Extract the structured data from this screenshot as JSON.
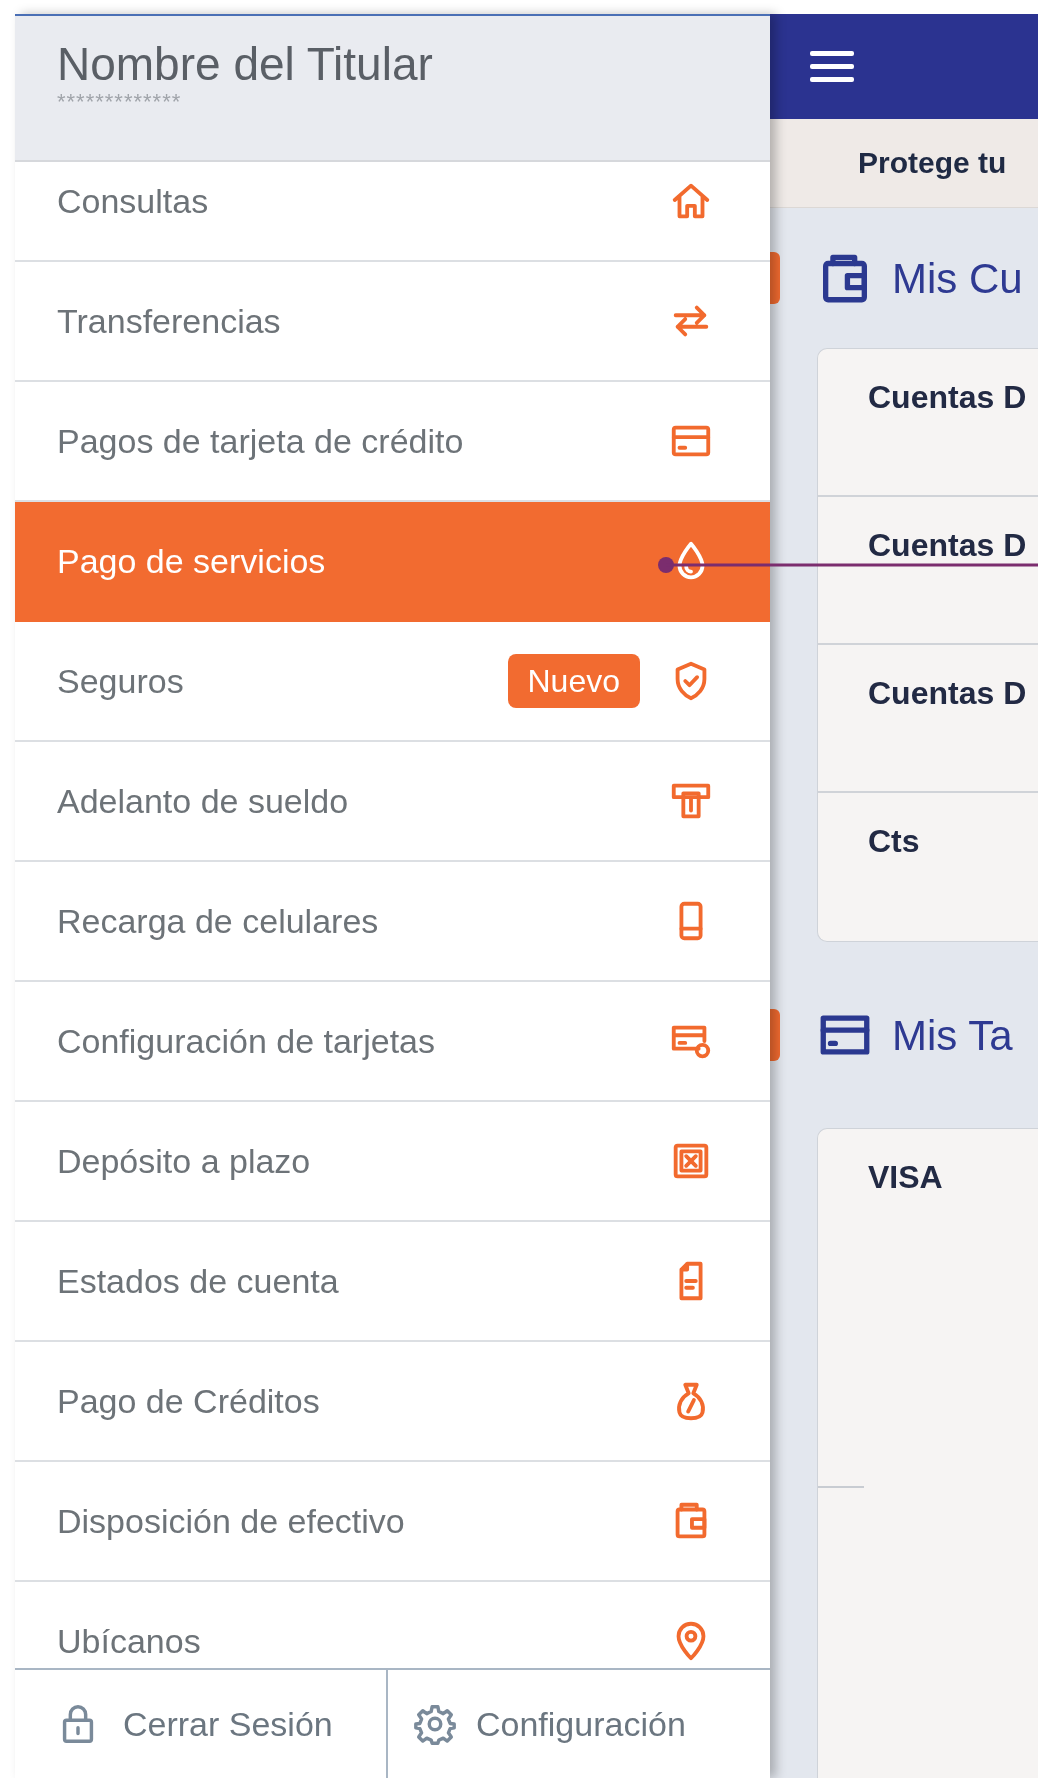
{
  "header": {
    "name": "Nombre del Titular",
    "masked_number": "*************"
  },
  "menu": [
    {
      "label": "Consultas",
      "selected": false
    },
    {
      "label": "Transferencias",
      "selected": false
    },
    {
      "label": "Pagos de tarjeta de crédito",
      "selected": false
    },
    {
      "label": "Pago de servicios",
      "selected": true
    },
    {
      "label": "Seguros",
      "selected": false,
      "badge": "Nuevo"
    },
    {
      "label": "Adelanto de sueldo",
      "selected": false
    },
    {
      "label": "Recarga de celulares",
      "selected": false
    },
    {
      "label": "Configuración de tarjetas",
      "selected": false
    },
    {
      "label": "Depósito a plazo",
      "selected": false
    },
    {
      "label": "Estados de cuenta",
      "selected": false
    },
    {
      "label": "Pago de Créditos",
      "selected": false
    },
    {
      "label": "Disposición de efectivo",
      "selected": false
    },
    {
      "label": "Ubícanos",
      "selected": false
    }
  ],
  "footer_buttons": [
    {
      "label": "Cerrar Sesión"
    },
    {
      "label": "Configuración"
    }
  ],
  "main": {
    "banner": "Protege tu",
    "sections": [
      {
        "title": "Mis Cu",
        "rows": [
          "Cuentas D",
          "Cuentas D",
          "Cuentas D",
          "Cts"
        ]
      },
      {
        "title": "Mis Ta",
        "rows": [
          "VISA"
        ]
      }
    ]
  }
}
